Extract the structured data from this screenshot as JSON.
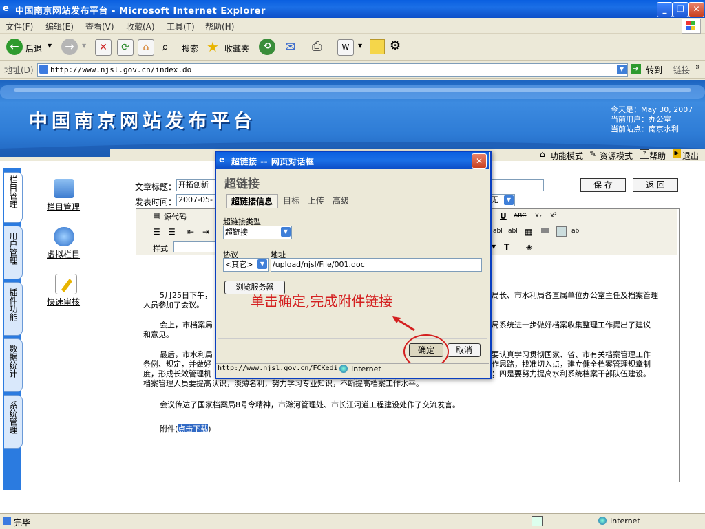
{
  "window": {
    "title": "中国南京网站发布平台 - Microsoft Internet Explorer",
    "min": "_",
    "max": "❐",
    "close": "✕"
  },
  "menu": [
    "文件(F)",
    "编辑(E)",
    "查看(V)",
    "收藏(A)",
    "工具(T)",
    "帮助(H)"
  ],
  "toolbar": {
    "back": "后退",
    "search": "搜索",
    "favorites": "收藏夹"
  },
  "address": {
    "label": "地址(D)",
    "url": "http://www.njsl.gov.cn/index.do",
    "go": "转到",
    "links": "链接"
  },
  "header": {
    "site_title": "中国南京网站发布平台",
    "today": "今天是：May 30, 2007",
    "user": "当前用户：办公室",
    "site": "当前站点：南京水利"
  },
  "nav": {
    "function_mode": "功能模式",
    "resource_mode": "资源模式",
    "help": "帮助",
    "logout": "退出"
  },
  "left_tabs": [
    "栏目管理",
    "用户管理",
    "插件功能",
    "数据统计",
    "系统管理"
  ],
  "left_links": [
    "栏目管理",
    "虚拟栏目",
    "快速审核"
  ],
  "form": {
    "title_label": "文章标题：",
    "title_value": "开拓创新",
    "time_label": "发表时间：",
    "time_value": "2007-05-",
    "select_value": "无",
    "save": "保 存",
    "back": "返 回"
  },
  "editor": {
    "source": "源代码",
    "style": "样式",
    "p1": "5月25日下午，",
    "p1b": "局长、市水利局各直属单位办公室主任及档案管理",
    "p1c": "人员参加了会议。",
    "p2": "会上，市档案局",
    "p2b": "局系统进一步做好档案收集整理工作提出了建议",
    "p2c": "和意见。",
    "p3": "最后，市水利局",
    "p3b": "要认真学习贯彻国家、省、市有关档案管理工作",
    "p3c": "条例、规定，并做好",
    "p3d": "作思路，找准切入点，建立健全档案管理规章制",
    "p3e": "度，形成长效管理机",
    "p3f": "；四是要努力提高水利系统档案干部队伍建设。",
    "p3g": "档案管理人员要提高认识，淡薄名利，努力学习专业知识，不断提高档案工作水平。",
    "p4": "会议传达了国家档案局8号令精神，市滁河管理处、市长江河道工程建设处作了交流发言。",
    "attach_prefix": "附件(",
    "attach_link": "点击下载",
    "attach_suffix": ")"
  },
  "dialog": {
    "title": "超链接 -- 网页对话框",
    "heading": "超链接",
    "tabs": [
      "超链接信息",
      "目标",
      "上传",
      "高级"
    ],
    "type_label": "超链接类型",
    "type_value": "超链接",
    "protocol_label": "协议",
    "protocol_value": "<其它>",
    "url_label": "地址",
    "url_value": "/upload/njsl/File/001.doc",
    "browse": "浏览服务器",
    "annotation": "单击确定,完成附件链接",
    "ok": "确定",
    "cancel": "取消",
    "status_url": "http://www.njsl.gov.cn/FCKedi",
    "status_zone": "Internet"
  },
  "status": {
    "text": "完毕",
    "zone": "Internet"
  }
}
